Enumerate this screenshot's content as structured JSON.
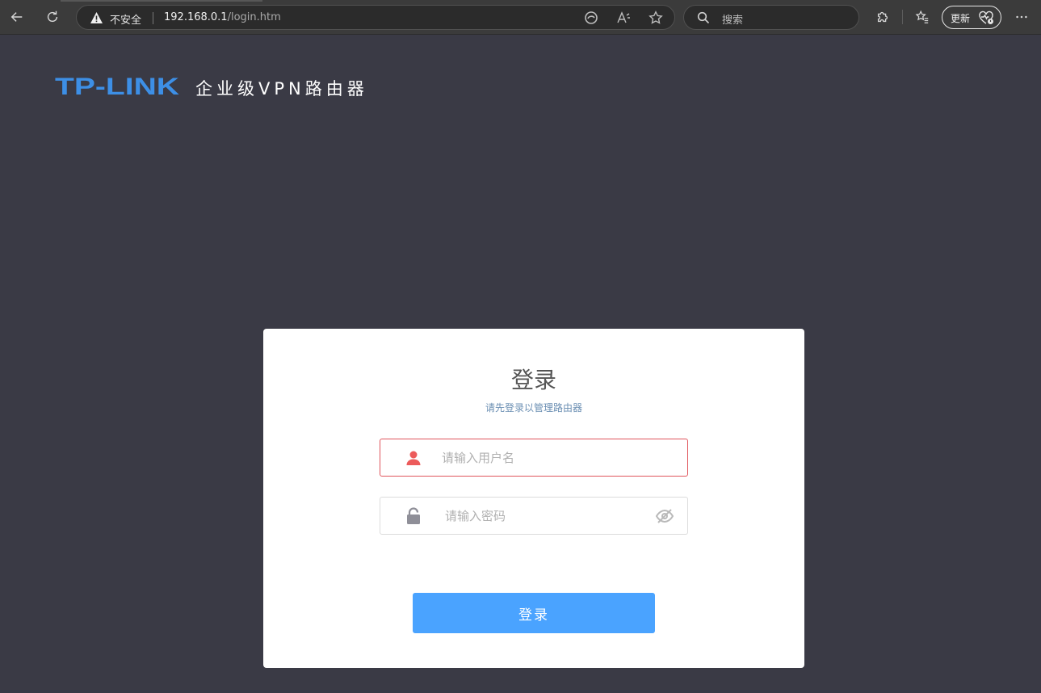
{
  "browser": {
    "insecure_label": "不安全",
    "url_host": "192.168.0.1",
    "url_path": "/login.htm",
    "search_placeholder": "搜索",
    "update_label": "更新"
  },
  "header": {
    "brand": "TP-LINK",
    "product": "企业级VPN路由器"
  },
  "login": {
    "title": "登录",
    "subtitle": "请先登录以管理路由器",
    "username_placeholder": "请输入用户名",
    "password_placeholder": "请输入密码",
    "submit_label": "登录"
  },
  "colors": {
    "page_bg": "#3a3a45",
    "brand_blue": "#3d8fe6",
    "button_blue": "#4aa3ff",
    "error_red": "#e0555c"
  }
}
